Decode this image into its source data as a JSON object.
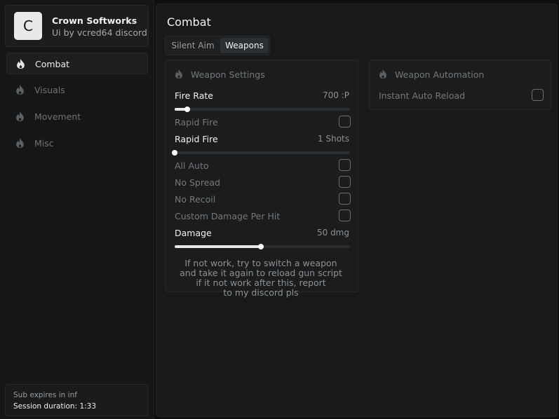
{
  "profile": {
    "avatar_letter": "C",
    "brand": "Crown Softworks",
    "subtitle": "Ui by vcred64 discord"
  },
  "nav": {
    "items": [
      {
        "label": "Combat",
        "icon": "flame-icon",
        "active": true
      },
      {
        "label": "Visuals",
        "icon": "flame-icon",
        "active": false
      },
      {
        "label": "Movement",
        "icon": "flame-icon",
        "active": false
      },
      {
        "label": "Misc",
        "icon": "flame-icon",
        "active": false
      }
    ]
  },
  "session": {
    "sub": "Sub expires in inf",
    "duration": "Session duration: 1:33"
  },
  "page": {
    "title": "Combat",
    "tabs": [
      {
        "label": "Silent Aim",
        "active": false
      },
      {
        "label": "Weapons",
        "active": true
      }
    ]
  },
  "weapon_settings": {
    "title": "Weapon Settings",
    "icon": "flame-icon",
    "fire_rate": {
      "label": "Fire Rate",
      "value": "700 :P",
      "level": 0.07
    },
    "rapid_fire_toggle": {
      "label": "Rapid Fire",
      "checked": false
    },
    "rapid_fire_slider": {
      "label": "Rapid Fire",
      "value": "1 Shots",
      "level": 0.0
    },
    "all_auto": {
      "label": "All Auto",
      "checked": false
    },
    "no_spread": {
      "label": "No Spread",
      "checked": false
    },
    "no_recoil": {
      "label": "No Recoil",
      "checked": false
    },
    "custom_damage": {
      "label": "Custom Damage Per Hit",
      "checked": false
    },
    "damage": {
      "label": "Damage",
      "value": "50 dmg",
      "level": 0.49
    },
    "note": [
      "If not work, try to switch a weapon",
      "and take it again to reload gun script",
      "if it not work after this, report",
      "to my discord pls"
    ]
  },
  "weapon_automation": {
    "title": "Weapon Automation",
    "icon": "flame-icon",
    "instant_auto_reload": {
      "label": "Instant Auto Reload",
      "checked": false
    }
  },
  "colors": {
    "background": "#0d0e0f",
    "sidebar": "#141617",
    "panel": "#1a1c1e",
    "accent": "#f2f2f2",
    "muted": "#75787a"
  }
}
